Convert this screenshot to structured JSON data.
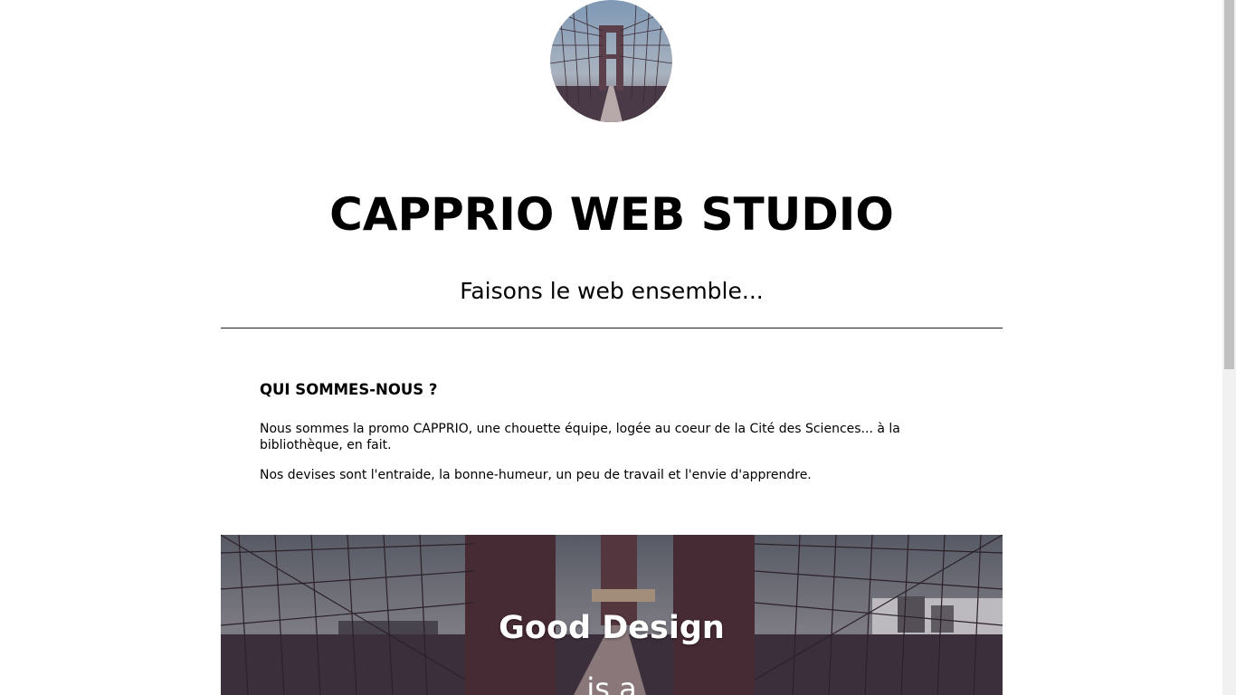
{
  "header": {
    "logo": "bridge-avatar",
    "title": "CAPPRIO WEB STUDIO",
    "tagline": "Faisons le web ensemble..."
  },
  "about": {
    "heading": "QUI SOMMES-NOUS ?",
    "paragraphs": [
      "Nous sommes la promo CAPPRIO, une chouette équipe, logée au coeur de la Cité des Sciences... à la bibliothèque, en fait.",
      "Nos devises sont l'entraide, la bonne-humeur, un peu de travail et l'envie d'apprendre."
    ]
  },
  "hero": {
    "title": "Good Design",
    "subtitle": "is a"
  },
  "colors": {
    "text": "#000000",
    "background": "#ffffff",
    "hero_text": "#ffffff"
  }
}
